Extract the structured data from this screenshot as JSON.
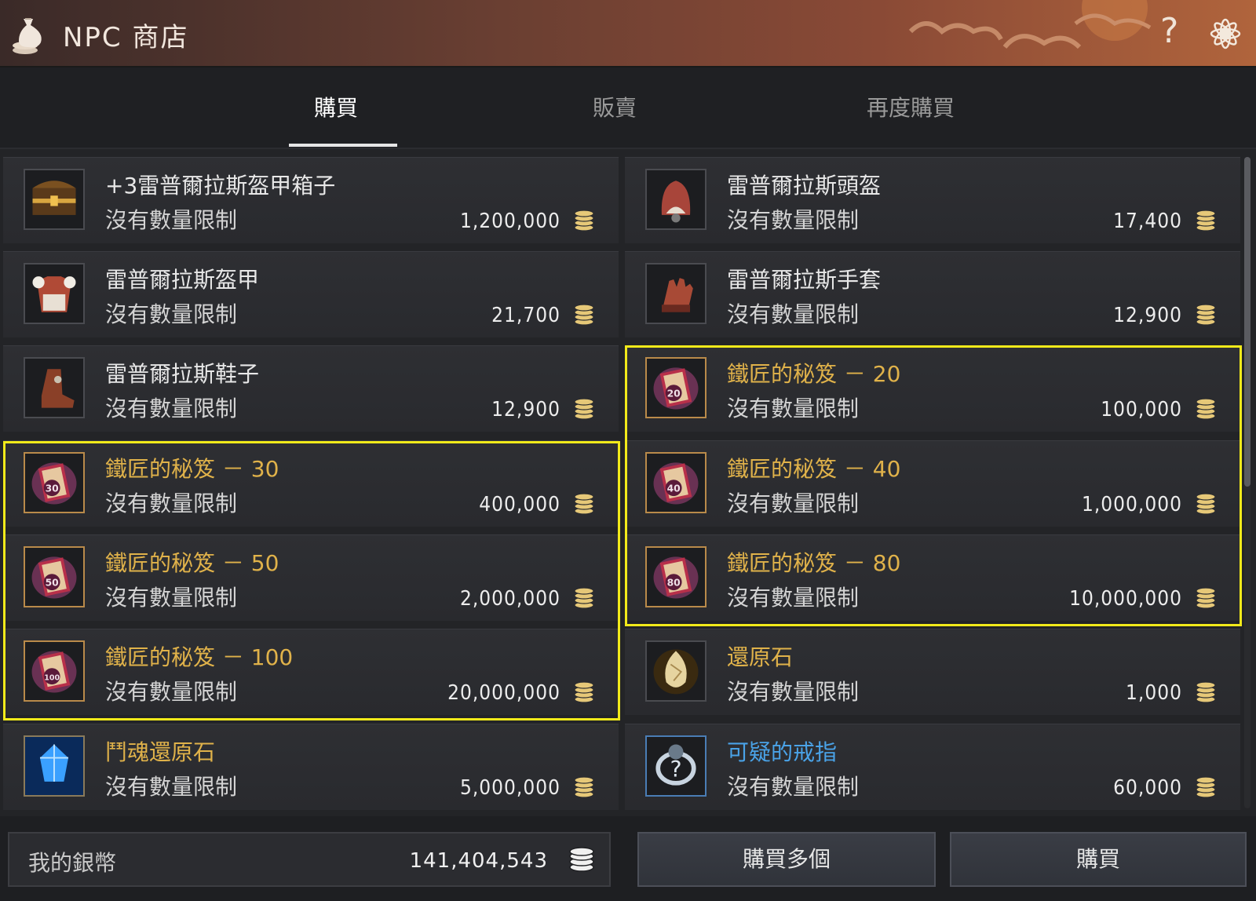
{
  "header": {
    "title": "NPC 商店",
    "help_glyph": "?"
  },
  "tabs": [
    {
      "label": "購買",
      "active": true
    },
    {
      "label": "販賣",
      "active": false
    },
    {
      "label": "再度購買",
      "active": false
    }
  ],
  "items": [
    {
      "name": "+3雷普爾拉斯盔甲箱子",
      "limit": "沒有數量限制",
      "price": "1,200,000",
      "icon": "chest-icon",
      "name_color": "white"
    },
    {
      "name": "雷普爾拉斯頭盔",
      "limit": "沒有數量限制",
      "price": "17,400",
      "icon": "helmet-icon",
      "name_color": "white"
    },
    {
      "name": "雷普爾拉斯盔甲",
      "limit": "沒有數量限制",
      "price": "21,700",
      "icon": "armor-icon",
      "name_color": "white"
    },
    {
      "name": "雷普爾拉斯手套",
      "limit": "沒有數量限制",
      "price": "12,900",
      "icon": "gloves-icon",
      "name_color": "white"
    },
    {
      "name": "雷普爾拉斯鞋子",
      "limit": "沒有數量限制",
      "price": "12,900",
      "icon": "boots-icon",
      "name_color": "white"
    },
    {
      "name": "鐵匠的秘笈 － 20",
      "limit": "沒有數量限制",
      "price": "100,000",
      "icon": "book-icon",
      "badge": "20",
      "name_color": "gold"
    },
    {
      "name": "鐵匠的秘笈 － 30",
      "limit": "沒有數量限制",
      "price": "400,000",
      "icon": "book-icon",
      "badge": "30",
      "name_color": "gold"
    },
    {
      "name": "鐵匠的秘笈 － 40",
      "limit": "沒有數量限制",
      "price": "1,000,000",
      "icon": "book-icon",
      "badge": "40",
      "name_color": "gold"
    },
    {
      "name": "鐵匠的秘笈 － 50",
      "limit": "沒有數量限制",
      "price": "2,000,000",
      "icon": "book-icon",
      "badge": "50",
      "name_color": "gold"
    },
    {
      "name": "鐵匠的秘笈 － 80",
      "limit": "沒有數量限制",
      "price": "10,000,000",
      "icon": "book-icon",
      "badge": "80",
      "name_color": "gold"
    },
    {
      "name": "鐵匠的秘笈 － 100",
      "limit": "沒有數量限制",
      "price": "20,000,000",
      "icon": "book-icon",
      "badge": "100",
      "name_color": "gold"
    },
    {
      "name": "還原石",
      "limit": "沒有數量限制",
      "price": "1,000",
      "icon": "restore-stone-icon",
      "name_color": "gold"
    },
    {
      "name": "鬥魂還原石",
      "limit": "沒有數量限制",
      "price": "5,000,000",
      "icon": "soul-stone-icon",
      "name_color": "gold"
    },
    {
      "name": "可疑的戒指",
      "limit": "沒有數量限制",
      "price": "60,000",
      "icon": "mystery-ring-icon",
      "name_color": "blue"
    }
  ],
  "footer": {
    "silver_label": "我的銀幣",
    "silver_value": "141,404,543",
    "buy_multiple_label": "購買多個",
    "buy_label": "購買"
  },
  "colors": {
    "highlight": "#f2ea1a",
    "gold_name": "#e0b24a",
    "blue_name": "#4aa3e8"
  }
}
